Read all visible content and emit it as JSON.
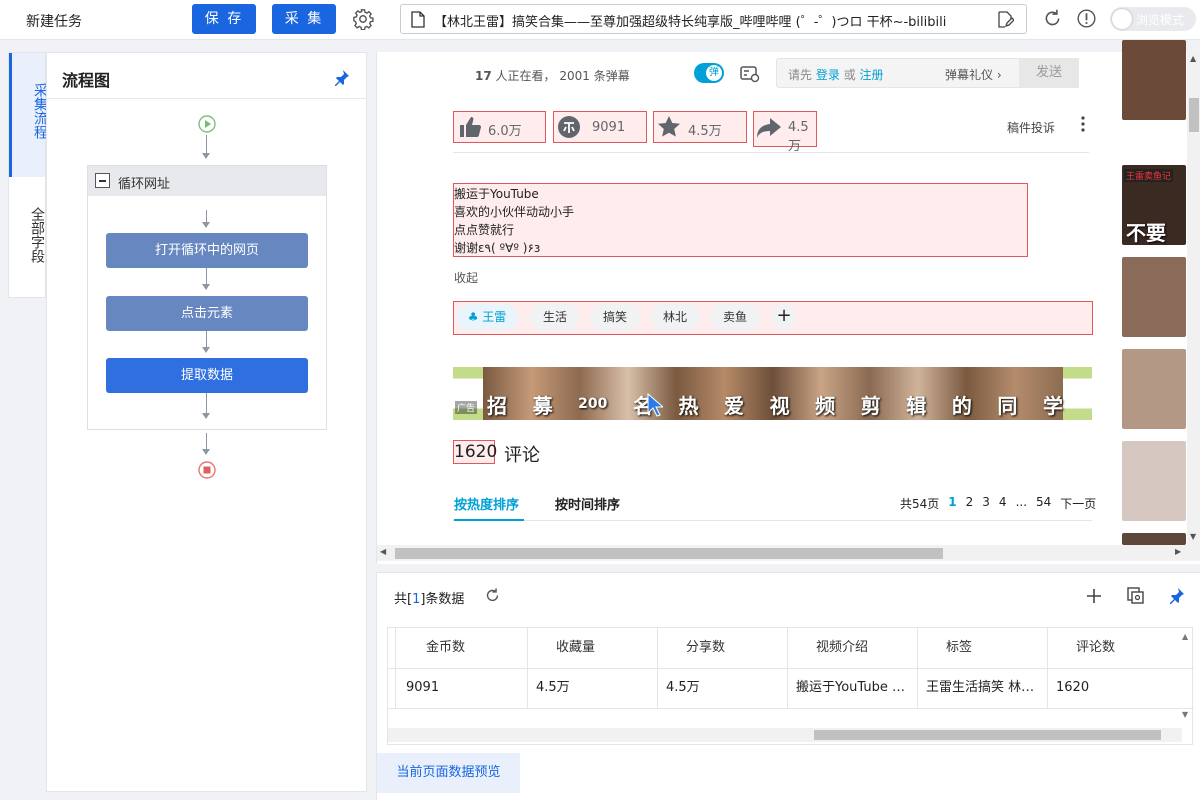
{
  "topbar": {
    "title": "新建任务",
    "save_label": "保 存",
    "collect_label": "采 集",
    "url_text": "【林北王雷】搞笑合集——至尊加强超级特长纯享版_哔哩哔哩 (゜-゜)つロ 干杯~-bilibili",
    "browse_mode_label": "浏览模式"
  },
  "side_tabs": [
    "采集流程",
    "全部字段"
  ],
  "flow": {
    "title": "流程图",
    "loop_label": "循环网址",
    "nodes": [
      "打开循环中的网页",
      "点击元素",
      "提取数据"
    ],
    "node_colors": [
      "#6787c0",
      "#6787c0",
      "#2f6fe0"
    ]
  },
  "browser": {
    "viewers_count": "17",
    "viewers_text": "人正在看，",
    "danmaku_text": "2001 条弹幕",
    "danmaku_toggle": "弹",
    "comment_prompt_prefix": "请先",
    "login_link": "登录",
    "or_text": "或",
    "register_link": "注册",
    "danmaku_etiquette": "弹幕礼仪",
    "send_label": "发送",
    "stats": {
      "like": "6.0万",
      "coin": "9091",
      "favorite": "4.5万",
      "share": "4.5万"
    },
    "report_label": "稿件投诉",
    "description_lines": [
      "搬运于YouTube",
      "喜欢的小伙伴动动小手",
      "点点赞就行",
      "谢谢ε٩( º∀º )۶з"
    ],
    "collapse_label": "收起",
    "tags": [
      "王雷",
      "生活",
      "搞笑",
      "林北",
      "卖鱼"
    ],
    "banner_label": "广告",
    "banner_chars": [
      "招",
      "募",
      "200",
      "名",
      "热",
      "爱",
      "视",
      "频",
      "剪",
      "辑",
      "的",
      "同",
      "学"
    ],
    "comment_count": "1620",
    "comment_label": "评论",
    "sort_hot": "按热度排序",
    "sort_time": "按时间排序",
    "pagination": {
      "total_pages": "共54页",
      "pages": [
        "1",
        "2",
        "3",
        "4",
        "...",
        "54"
      ],
      "next": "下一页"
    },
    "thumb_captions": [
      "",
      "王雷卖鱼记",
      "不要",
      "",
      "",
      "",
      ""
    ],
    "thumb_colors": [
      "#6b4a3a",
      "#3a2a22",
      "#8a6a58",
      "#b49886",
      "#6a4e40",
      "#d6c8c0",
      "#5e4638"
    ]
  },
  "data_panel": {
    "count_prefix": "共[",
    "count_value": "1",
    "count_suffix": "]条数据",
    "columns": [
      "金币数",
      "收藏量",
      "分享数",
      "视频介绍",
      "标签",
      "评论数"
    ],
    "rows": [
      [
        "9091",
        "4.5万",
        "4.5万",
        "搬运于YouTube 喜欢的小伙伴...",
        "王雷生活搞笑 林北卖鱼",
        "1620"
      ]
    ],
    "preview_tab": "当前页面数据预览"
  }
}
